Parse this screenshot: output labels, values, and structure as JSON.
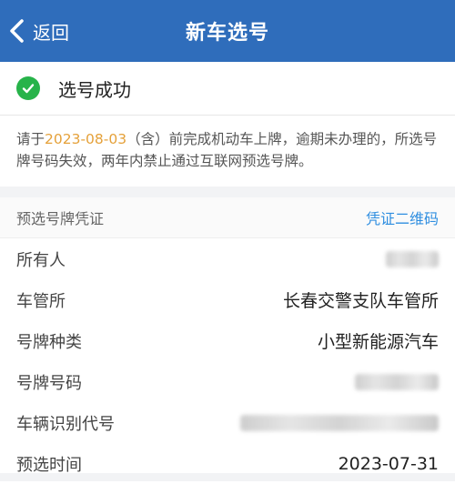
{
  "nav": {
    "back_label": "返回",
    "title": "新车选号"
  },
  "status": {
    "text": "选号成功",
    "icon": "check-circle-icon",
    "color": "#27b34a"
  },
  "notice": {
    "prefix": "请于",
    "date": "2023-08-03",
    "suffix": "（含）前完成机动车上牌，逾期未办理的，所选号牌号码失效，两年内禁止通过互联网预选号牌。"
  },
  "voucher": {
    "label": "预选号牌凭证",
    "qr_link": "凭证二维码"
  },
  "rows": [
    {
      "key": "所有人",
      "value": ""
    },
    {
      "key": "车管所",
      "value": "长春交警支队车管所"
    },
    {
      "key": "号牌种类",
      "value": "小型新能源汽车"
    },
    {
      "key": "号牌号码",
      "value": ""
    },
    {
      "key": "车辆识别代号",
      "value": ""
    },
    {
      "key": "预选时间",
      "value": "2023-07-31"
    }
  ],
  "colors": {
    "navbar": "#2f6dbb",
    "accent_date": "#e5a13a",
    "link": "#2f8ee0"
  }
}
